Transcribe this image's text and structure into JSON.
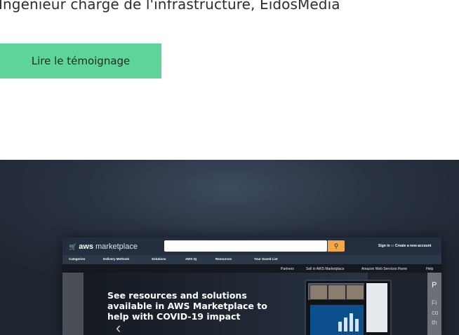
{
  "intro": {
    "subtitle": "Ingénieur chargé de l'infrastructure, EidosMedia",
    "cta_label": "Lire le témoignage"
  },
  "mockup": {
    "logo_bold": "aws",
    "logo_text": "marketplace",
    "search_icon": "search-icon",
    "signin": "Sign in",
    "or": "or",
    "create_account": "Create a new account",
    "nav": [
      "Categories",
      "Delivery Methods",
      "Solutions",
      "AWS IQ",
      "Resources",
      "Your Saved List"
    ],
    "subnav": [
      "Partners",
      "Sell in AWS Marketplace",
      "Amazon Web Services Home",
      "Help"
    ],
    "banner_text": "See resources and solutions available in AWS Marketplace to help with COVID-19 impact",
    "side_title": "P",
    "side_lines": [
      "Fi",
      "co",
      "th"
    ]
  },
  "colors": {
    "cta": "#5fd498",
    "search_button": "#f3a847",
    "header": "#232f3e"
  }
}
